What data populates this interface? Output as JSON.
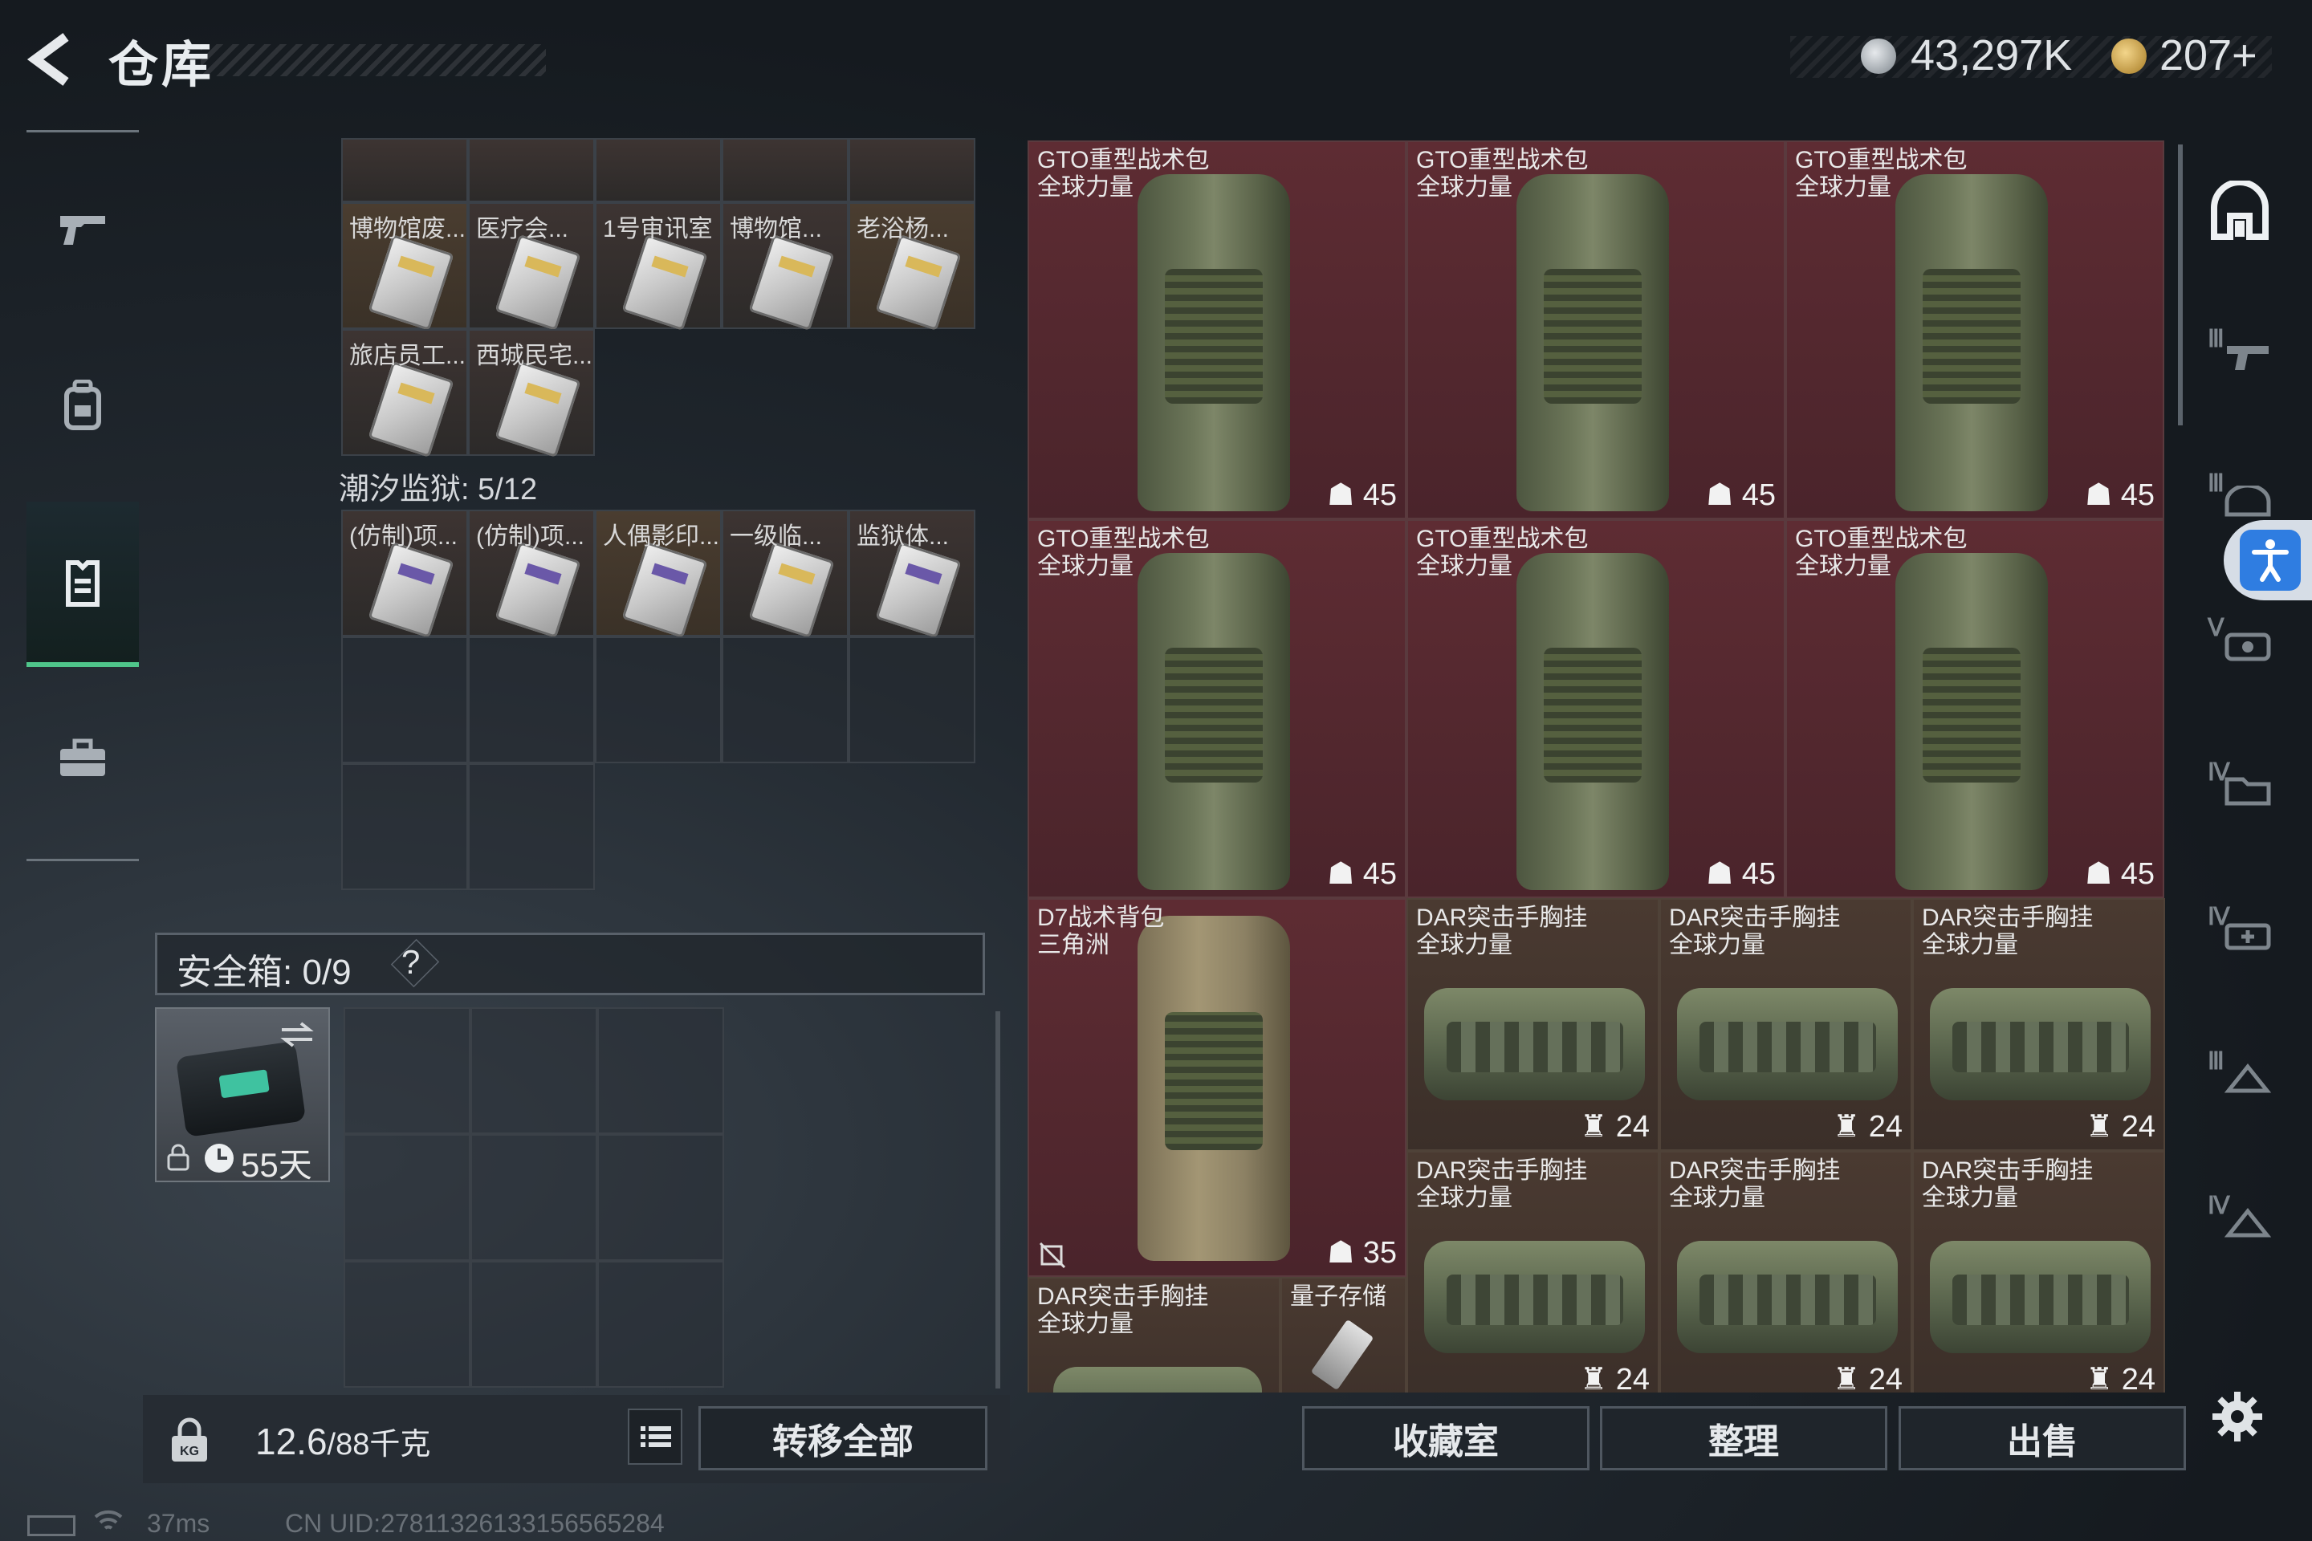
{
  "header": {
    "title": "仓库",
    "currency_main": "43,297K",
    "currency_premium": "207+"
  },
  "stash": {
    "top_row_labels": [
      "",
      "",
      "",
      "",
      ""
    ],
    "row1_labels": [
      "博物馆废...",
      "医疗会...",
      "1号审讯室",
      "博物馆...",
      "老浴杨..."
    ],
    "row2_labels": [
      "旅店员工...",
      "西城民宅..."
    ],
    "section_label": "潮汐监狱: 5/12",
    "row3_labels": [
      "(仿制)项...",
      "(仿制)项...",
      "人偶影印...",
      "一级临...",
      "监狱体..."
    ]
  },
  "safe_box": {
    "label": "安全箱: 0/9",
    "help": "?",
    "days": "55天"
  },
  "footer": {
    "weight_value": "12.6",
    "weight_unit": "/88千克",
    "transfer_all": "转移全部",
    "collection": "收藏室",
    "sort": "整理",
    "sell": "出售"
  },
  "right_items": [
    {
      "name1": "GTO重型战术包",
      "name2": "全球力量",
      "cap": "45"
    },
    {
      "name1": "GTO重型战术包",
      "name2": "全球力量",
      "cap": "45"
    },
    {
      "name1": "GTO重型战术包",
      "name2": "全球力量",
      "cap": "45"
    },
    {
      "name1": "GTO重型战术包",
      "name2": "全球力量",
      "cap": "45"
    },
    {
      "name1": "GTO重型战术包",
      "name2": "全球力量",
      "cap": "45"
    },
    {
      "name1": "GTO重型战术包",
      "name2": "全球力量",
      "cap": "45"
    },
    {
      "name1": "D7战术背包",
      "name2": "三角洲",
      "cap": "35"
    },
    {
      "name1": "DAR突击手胸挂",
      "name2": "全球力量",
      "cap": "24"
    },
    {
      "name1": "DAR突击手胸挂",
      "name2": "全球力量",
      "cap": "24"
    },
    {
      "name1": "DAR突击手胸挂",
      "name2": "全球力量",
      "cap": "24"
    },
    {
      "name1": "DAR突击手胸挂",
      "name2": "全球力量",
      "cap": "24"
    },
    {
      "name1": "DAR突击手胸挂",
      "name2": "全球力量",
      "cap": "24"
    },
    {
      "name1": "DAR突击手胸挂",
      "name2": "全球力量",
      "cap": "24"
    },
    {
      "name1": "DAR突击手胸挂",
      "name2": "全球力量",
      "cap": ""
    },
    {
      "name1": "量子存储",
      "name2": "",
      "cap": ""
    }
  ],
  "status": {
    "ping": "37ms",
    "uid": "CN UID:27811326133156565284"
  },
  "icons": {
    "back": "back-arrow-icon",
    "nav": [
      "gun-icon",
      "backpack-icon",
      "vest-icon",
      "toolbox-icon"
    ],
    "right_nav": [
      "home-icon",
      "tier3-gun-icon",
      "tier3-helmet-icon",
      "tier5-rig-icon",
      "tier4-folder-icon",
      "tier4-medkit-icon",
      "tier3-shield-icon",
      "tier4-shield-icon"
    ],
    "settings": "gear-icon",
    "accessibility": "accessibility-icon"
  },
  "colors": {
    "accent_green": "#4fc58a",
    "item_bg": "#5e2c33",
    "accessibility_blue": "#2f7de1"
  }
}
